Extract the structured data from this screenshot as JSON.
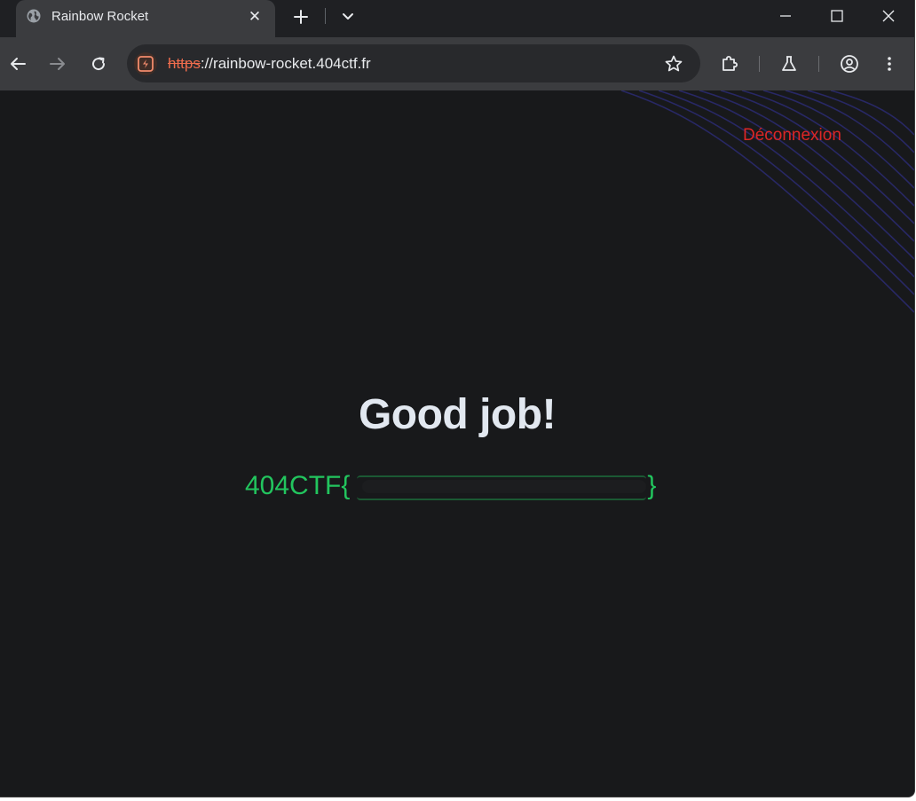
{
  "browser": {
    "tab": {
      "title": "Rainbow Rocket",
      "close_glyph": "✕",
      "favicon": "globe-icon"
    },
    "url": {
      "scheme": "https",
      "rest": "://rainbow-rocket.404ctf.fr",
      "security": "not-secure"
    },
    "colors": {
      "frame": "#1f2023",
      "toolbar": "#3b3c3f",
      "omnibox": "#28292c",
      "insecure_scheme": "#ee6c4d"
    }
  },
  "page": {
    "logout_label": "Déconnexion",
    "headline": "Good job!",
    "flag_prefix": "404CTF",
    "flag_open": "{",
    "flag_close": "}",
    "flag_value_redacted": true,
    "colors": {
      "background": "#18191b",
      "logout": "#dc2626",
      "headline": "#e2e8f0",
      "flag": "#22c55e",
      "waves": "#2a2a6e"
    }
  }
}
